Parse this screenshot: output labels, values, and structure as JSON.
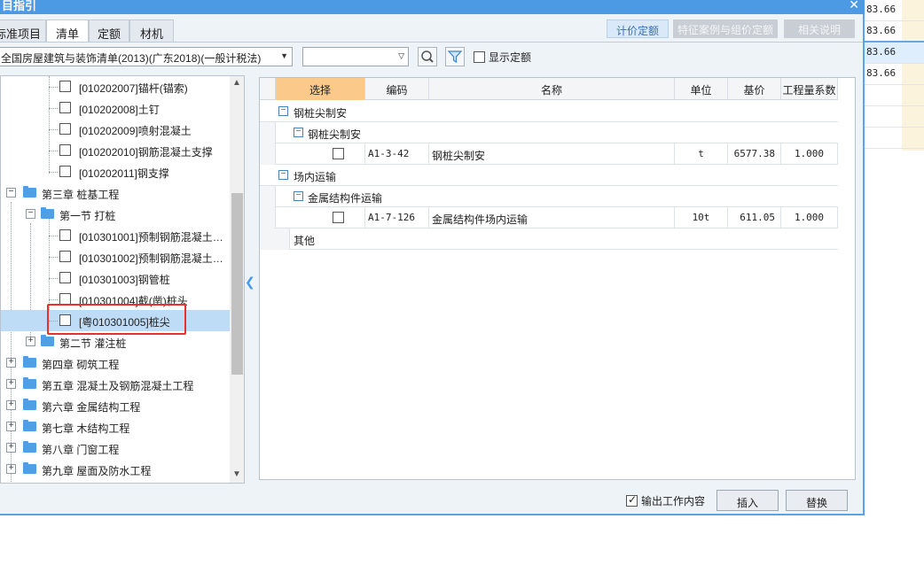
{
  "window": {
    "title": "目指引",
    "close_glyph": "✕"
  },
  "right_bg": {
    "values": [
      "83.66",
      "83.66",
      "83.66",
      "83.66"
    ]
  },
  "tabs": [
    "标准项目",
    "清单",
    "定额",
    "材机"
  ],
  "top_buttons": [
    "计价定额",
    "特征案例与组价定额",
    "相关说明"
  ],
  "library_select": {
    "value": "全国房屋建筑与装饰清单(2013)(广东2018)(一般计税法)"
  },
  "search": {
    "value": "",
    "placeholder": ""
  },
  "show_quota": {
    "label": "显示定额",
    "checked": false
  },
  "tree": [
    {
      "label": "[010202007]锚杆(锚索)"
    },
    {
      "label": "[010202008]土钉"
    },
    {
      "label": "[010202009]喷射混凝土"
    },
    {
      "label": "[010202010]钢筋混凝土支撑"
    },
    {
      "label": "[010202011]钢支撑"
    },
    {
      "label": "第三章  桩基工程"
    },
    {
      "label": "第一节  打桩"
    },
    {
      "label": "[010301001]预制钢筋混凝土…"
    },
    {
      "label": "[010301002]预制钢筋混凝土…"
    },
    {
      "label": "[010301003]钢管桩"
    },
    {
      "label": "[010301004]截(凿)桩头"
    },
    {
      "label": "[粤010301005]桩尖"
    },
    {
      "label": "第二节  灌注桩"
    },
    {
      "label": "第四章  砌筑工程"
    },
    {
      "label": "第五章  混凝土及钢筋混凝土工程"
    },
    {
      "label": "第六章  金属结构工程"
    },
    {
      "label": "第七章  木结构工程"
    },
    {
      "label": "第八章  门窗工程"
    },
    {
      "label": "第九章  屋面及防水工程"
    }
  ],
  "grid": {
    "headers": [
      "选择",
      "编码",
      "名称",
      "单位",
      "基价",
      "工程量系数"
    ],
    "groups": [
      {
        "label": "钢桩尖制安"
      },
      {
        "label": "钢桩尖制安"
      },
      {
        "label": "场内运输"
      },
      {
        "label": "金属结构件运输"
      },
      {
        "label": "其他"
      }
    ],
    "rows": [
      {
        "code": "A1-3-42",
        "name": "钢桩尖制安",
        "unit": "t",
        "price": "6577.38",
        "coef": "1.000"
      },
      {
        "code": "A1-7-126",
        "name": "金属结构件场内运输",
        "unit": "10t",
        "price": "611.05",
        "coef": "1.000"
      }
    ]
  },
  "footer": {
    "output_work": {
      "label": "输出工作内容",
      "checked": true
    },
    "insert": "插入",
    "replace": "替换"
  }
}
